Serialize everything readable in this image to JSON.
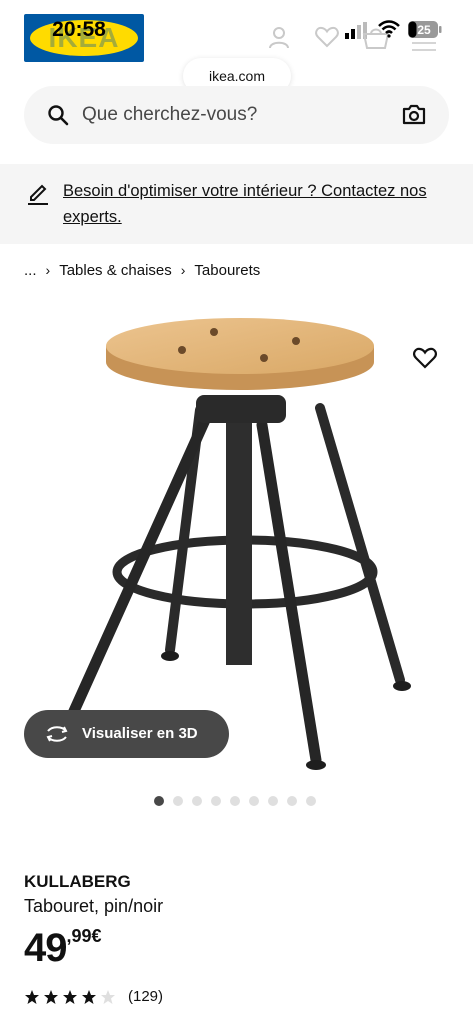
{
  "status_bar": {
    "time": "20:58",
    "battery": "25"
  },
  "header": {
    "logo": "IKEA",
    "url": "ikea.com"
  },
  "search": {
    "placeholder": "Que cherchez-vous?"
  },
  "banner": {
    "text": "Besoin d'optimiser votre intérieur ? Contactez nos experts."
  },
  "breadcrumb": {
    "ellipsis": "...",
    "items": [
      "Tables & chaises",
      "Tabourets"
    ]
  },
  "media": {
    "view3d_label": "Visualiser en 3D",
    "image_count": 9,
    "active_index": 0
  },
  "product": {
    "name": "KULLABERG",
    "description": "Tabouret, pin/noir",
    "price_integer": "49",
    "price_decimal": ",99€",
    "rating": 4,
    "rating_max": 5,
    "review_count": "(129)"
  },
  "colors": {
    "ikea_blue": "#0058a3",
    "ikea_yellow": "#ffdb00",
    "button_dark": "#484848",
    "panel_gray": "#f5f5f5"
  },
  "icons": [
    "user-icon",
    "heart-icon",
    "cart-icon",
    "search-icon",
    "camera-icon",
    "pencil-icon",
    "rotate-3d-icon",
    "star-icon"
  ]
}
